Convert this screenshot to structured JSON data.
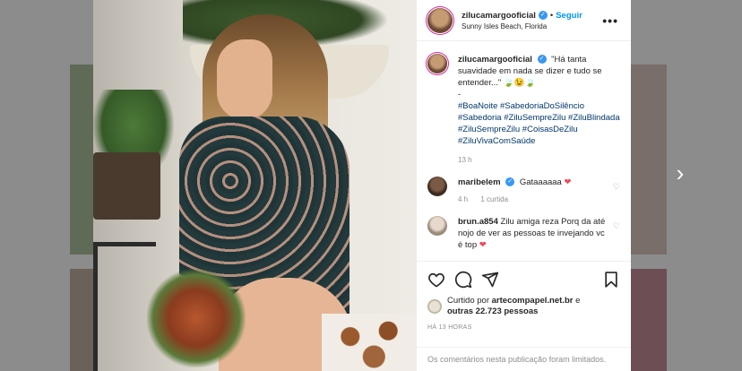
{
  "post": {
    "username": "zilucamargooficial",
    "follow_label": "Seguir",
    "location": "Sunny Isles Beach, Florida",
    "more_label": "•••",
    "caption": "\"Há tanta suavidade em nada se dizer e tudo se entender...\" 🍃😉🍃",
    "caption_dash": "-",
    "hashtags": "#BoaNoite #SabedoriaDoSilêncio #Sabedoria #ZiluSempreZilu #ZiluBlindada #ZiluSempreZilu #CoisasDeZilu #ZiluVivaComSaúde",
    "caption_time": "13 h"
  },
  "comments": [
    {
      "username": "maribelem",
      "text": "Gataaaaaa",
      "heart": "❤",
      "time": "4 h",
      "likes": "1 curtida"
    },
    {
      "username": "brun.a854",
      "text": "Zilu amiga reza Porq da até nojo de ver as pessoas te invejando vc é top",
      "heart": "❤"
    }
  ],
  "likes": {
    "prefix": "Curtido por",
    "user": "artecompapel.net.br",
    "connector": "e",
    "others": "outras 22.723 pessoas"
  },
  "timestamp": "HÁ 13 HORAS",
  "comments_limited": "Os comentários nesta publicação foram limitados.",
  "icons": [
    "heart-icon",
    "comment-icon",
    "share-icon",
    "bookmark-icon",
    "chevron-right-icon",
    "verified-icon"
  ],
  "colors": {
    "link": "#0095f6",
    "hashtag": "#00376b",
    "verified": "#3897f0",
    "heart": "#ed4956"
  }
}
